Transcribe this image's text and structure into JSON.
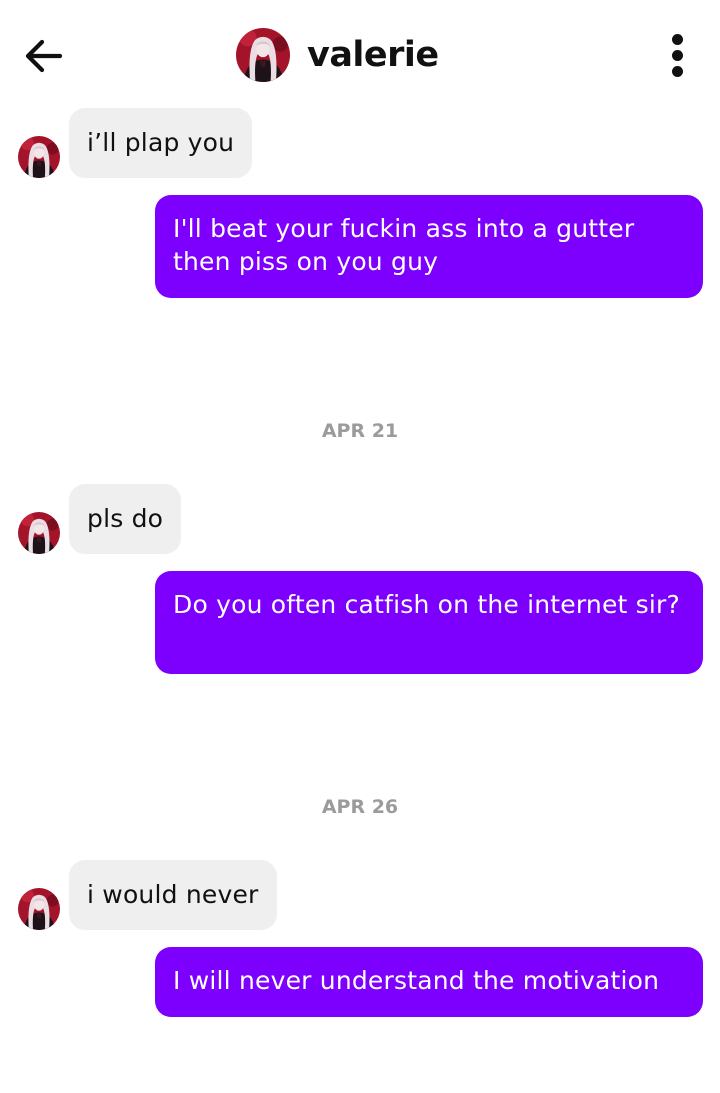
{
  "header": {
    "back_icon": "back-arrow-icon",
    "contact_name": "valerie",
    "menu_icon": "more-vertical-icon"
  },
  "colors": {
    "outgoing_bubble": "#7d00fe",
    "incoming_bubble": "#efefef",
    "date_text": "#9b9b9b"
  },
  "messages": [
    {
      "direction": "incoming",
      "text": "i’ll plap you"
    },
    {
      "direction": "outgoing",
      "text": "I'll beat your fuckin ass into a gutter then piss on you guy"
    },
    {
      "direction": "date",
      "text": "APR 21"
    },
    {
      "direction": "incoming",
      "text": "pls do"
    },
    {
      "direction": "outgoing",
      "text": "Do you often catfish on the internet sir?"
    },
    {
      "direction": "date",
      "text": "APR 26"
    },
    {
      "direction": "incoming",
      "text": "i would never"
    },
    {
      "direction": "outgoing",
      "text": "I will never understand the motivation"
    }
  ]
}
